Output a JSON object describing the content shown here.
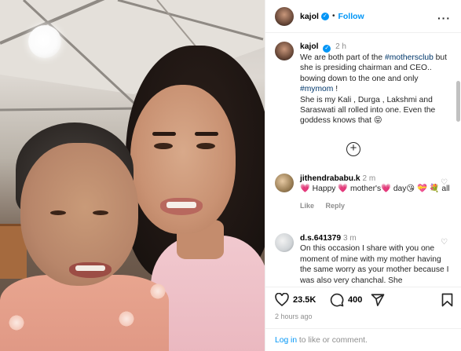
{
  "header": {
    "username": "kajol",
    "follow_label": "Follow",
    "dot": "•",
    "more": "···"
  },
  "caption": {
    "username": "kajol",
    "time": "2 h",
    "before_tag1": "We are both part of the ",
    "tag1": "#mothersclub",
    "mid1": " but she is presiding chairman and CEO.. bowing down to the one and only ",
    "tag2": "#mymom",
    "mid2": " !",
    "line2": "She is my Kali , Durga , Lakshmi and Saraswati all rolled into one. Even the goddess knows that 😝"
  },
  "add_icon": "+",
  "comments": [
    {
      "username": "jithendrababu.k",
      "time": "2 m",
      "text": "💗 Happy 💗 mother's💗 day😘 💝 💐 all",
      "like_label": "Like",
      "reply_label": "Reply"
    },
    {
      "username": "d.s.641379",
      "time": "3 m",
      "text": "On this occasion I share with you one moment of mine with my mother having the same worry as your mother because I was also very chanchal. She"
    }
  ],
  "actions": {
    "likes": "23.5K",
    "comments": "400"
  },
  "posted_ago": "2 hours ago",
  "login": {
    "link": "Log in",
    "rest": " to like or comment."
  },
  "icons": {
    "heart": "heart-icon",
    "comment": "comment-icon",
    "share": "share-icon",
    "save": "bookmark-icon",
    "verified": "verified-badge-icon"
  },
  "colors": {
    "accent": "#0095f6",
    "hashtag": "#00376b",
    "muted": "#8e8e8e"
  }
}
